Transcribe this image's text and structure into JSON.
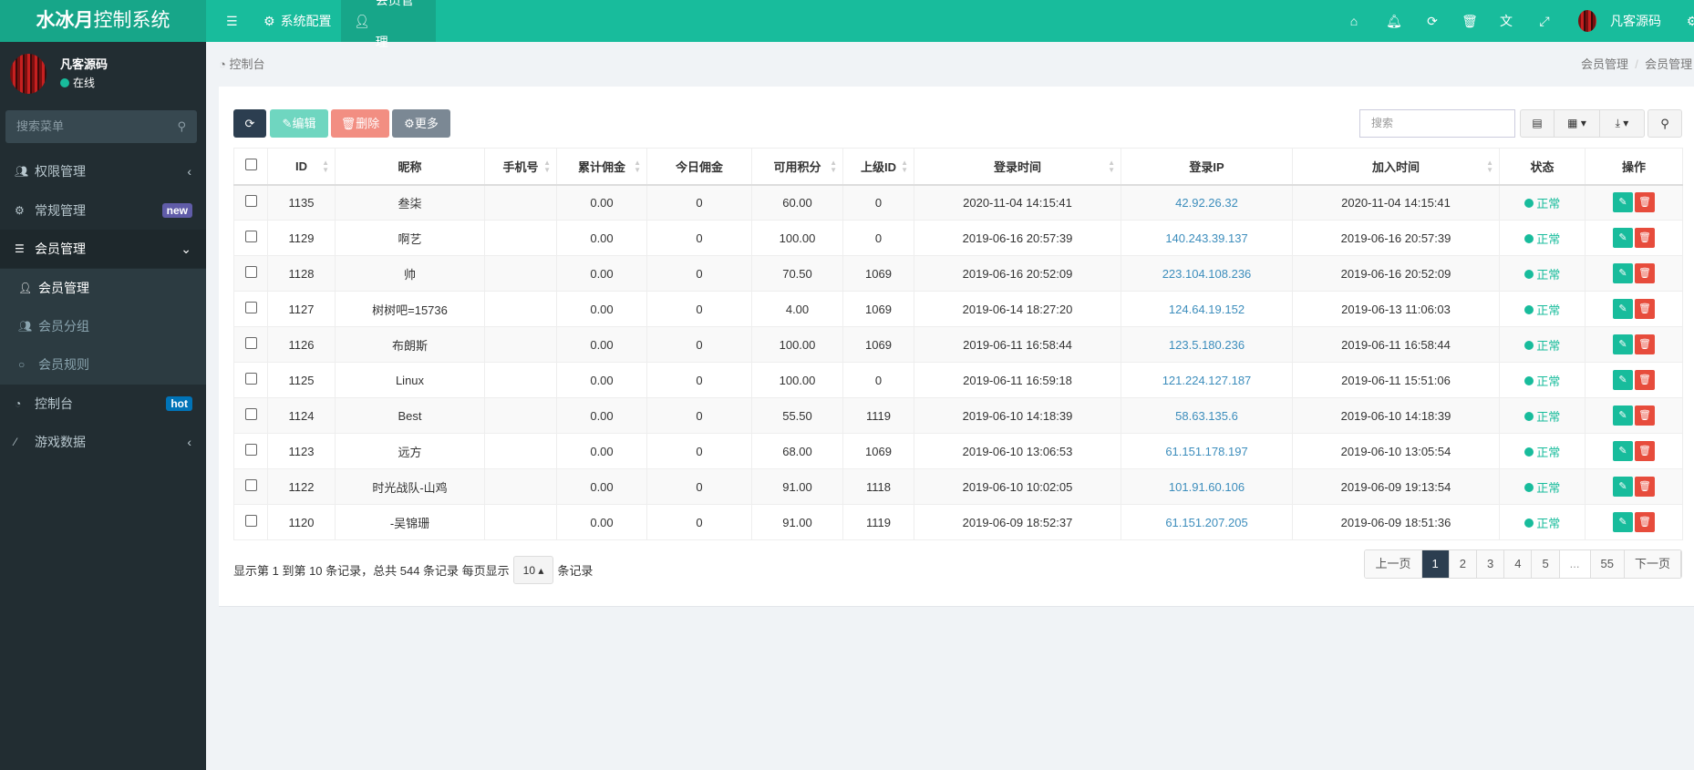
{
  "app": {
    "title_bold": "水冰月",
    "title_rest": "控制系统"
  },
  "topnav": [
    {
      "label": "系统配置",
      "icon": "gear-icon"
    },
    {
      "label": "会员管理",
      "icon": "user-icon"
    }
  ],
  "topright": {
    "icons": [
      "home-icon",
      "bell-icon",
      "refresh-icon",
      "trash-icon",
      "translate-icon",
      "fullscreen-icon"
    ],
    "username": "凡客源码"
  },
  "user": {
    "name": "凡客源码",
    "status": "在线"
  },
  "sidebar": {
    "search_placeholder": "搜索菜单",
    "items": [
      {
        "label": "权限管理",
        "icon": "users-icon"
      },
      {
        "label": "常规管理",
        "icon": "cogs-icon",
        "badge": "new",
        "badge_color": "#605ca8"
      },
      {
        "label": "会员管理",
        "icon": "list-icon"
      },
      {
        "label": "会员管理",
        "icon": "user-icon"
      },
      {
        "label": "会员分组",
        "icon": "users-icon"
      },
      {
        "label": "会员规则",
        "icon": "circle-icon"
      },
      {
        "label": "控制台",
        "icon": "dashboard-icon",
        "badge": "hot",
        "badge_color": "#0073b7"
      },
      {
        "label": "游戏数据",
        "icon": "magic-icon"
      }
    ]
  },
  "breadcrumb": {
    "left": "控制台",
    "right": [
      "会员管理",
      "会员管理"
    ]
  },
  "toolbar": {
    "edit": "编辑",
    "delete": "删除",
    "more": "更多",
    "search_placeholder": "搜索"
  },
  "table": {
    "headers": [
      "ID",
      "昵称",
      "手机号",
      "累计佣金",
      "今日佣金",
      "可用积分",
      "上级ID",
      "登录时间",
      "登录IP",
      "加入时间",
      "状态",
      "操作"
    ],
    "rows": [
      [
        "1135",
        "叁柒",
        "",
        "0.00",
        "0",
        "60.00",
        "0",
        "2020-11-04 14:15:41",
        "42.92.26.32",
        "2020-11-04 14:15:41",
        "正常"
      ],
      [
        "1129",
        "啊艺",
        "",
        "0.00",
        "0",
        "100.00",
        "0",
        "2019-06-16 20:57:39",
        "140.243.39.137",
        "2019-06-16 20:57:39",
        "正常"
      ],
      [
        "1128",
        "帅",
        "",
        "0.00",
        "0",
        "70.50",
        "1069",
        "2019-06-16 20:52:09",
        "223.104.108.236",
        "2019-06-16 20:52:09",
        "正常"
      ],
      [
        "1127",
        "树树吧=15736",
        "",
        "0.00",
        "0",
        "4.00",
        "1069",
        "2019-06-14 18:27:20",
        "124.64.19.152",
        "2019-06-13 11:06:03",
        "正常"
      ],
      [
        "1126",
        "布朗斯",
        "",
        "0.00",
        "0",
        "100.00",
        "1069",
        "2019-06-11 16:58:44",
        "123.5.180.236",
        "2019-06-11 16:58:44",
        "正常"
      ],
      [
        "1125",
        "Linux",
        "",
        "0.00",
        "0",
        "100.00",
        "0",
        "2019-06-11 16:59:18",
        "121.224.127.187",
        "2019-06-11 15:51:06",
        "正常"
      ],
      [
        "1124",
        "Best",
        "",
        "0.00",
        "0",
        "55.50",
        "1119",
        "2019-06-10 14:18:39",
        "58.63.135.6",
        "2019-06-10 14:18:39",
        "正常"
      ],
      [
        "1123",
        "远方",
        "",
        "0.00",
        "0",
        "68.00",
        "1069",
        "2019-06-10 13:06:53",
        "61.151.178.197",
        "2019-06-10 13:05:54",
        "正常"
      ],
      [
        "1122",
        "时光战队-山鸡",
        "",
        "0.00",
        "0",
        "91.00",
        "1118",
        "2019-06-10 10:02:05",
        "101.91.60.106",
        "2019-06-09 19:13:54",
        "正常"
      ],
      [
        "1120",
        "-吴锦珊",
        "",
        "0.00",
        "0",
        "91.00",
        "1119",
        "2019-06-09 18:52:37",
        "61.151.207.205",
        "2019-06-09 18:51:36",
        "正常"
      ]
    ]
  },
  "footer": {
    "summary": "显示第 1 到第 10 条记录，总共 544 条记录 每页显示",
    "page_size": "10",
    "suffix": "条记录"
  },
  "pagination": {
    "prev": "上一页",
    "pages": [
      "1",
      "2",
      "3",
      "4",
      "5",
      "...",
      "55"
    ],
    "current": "1",
    "next": "下一页"
  }
}
